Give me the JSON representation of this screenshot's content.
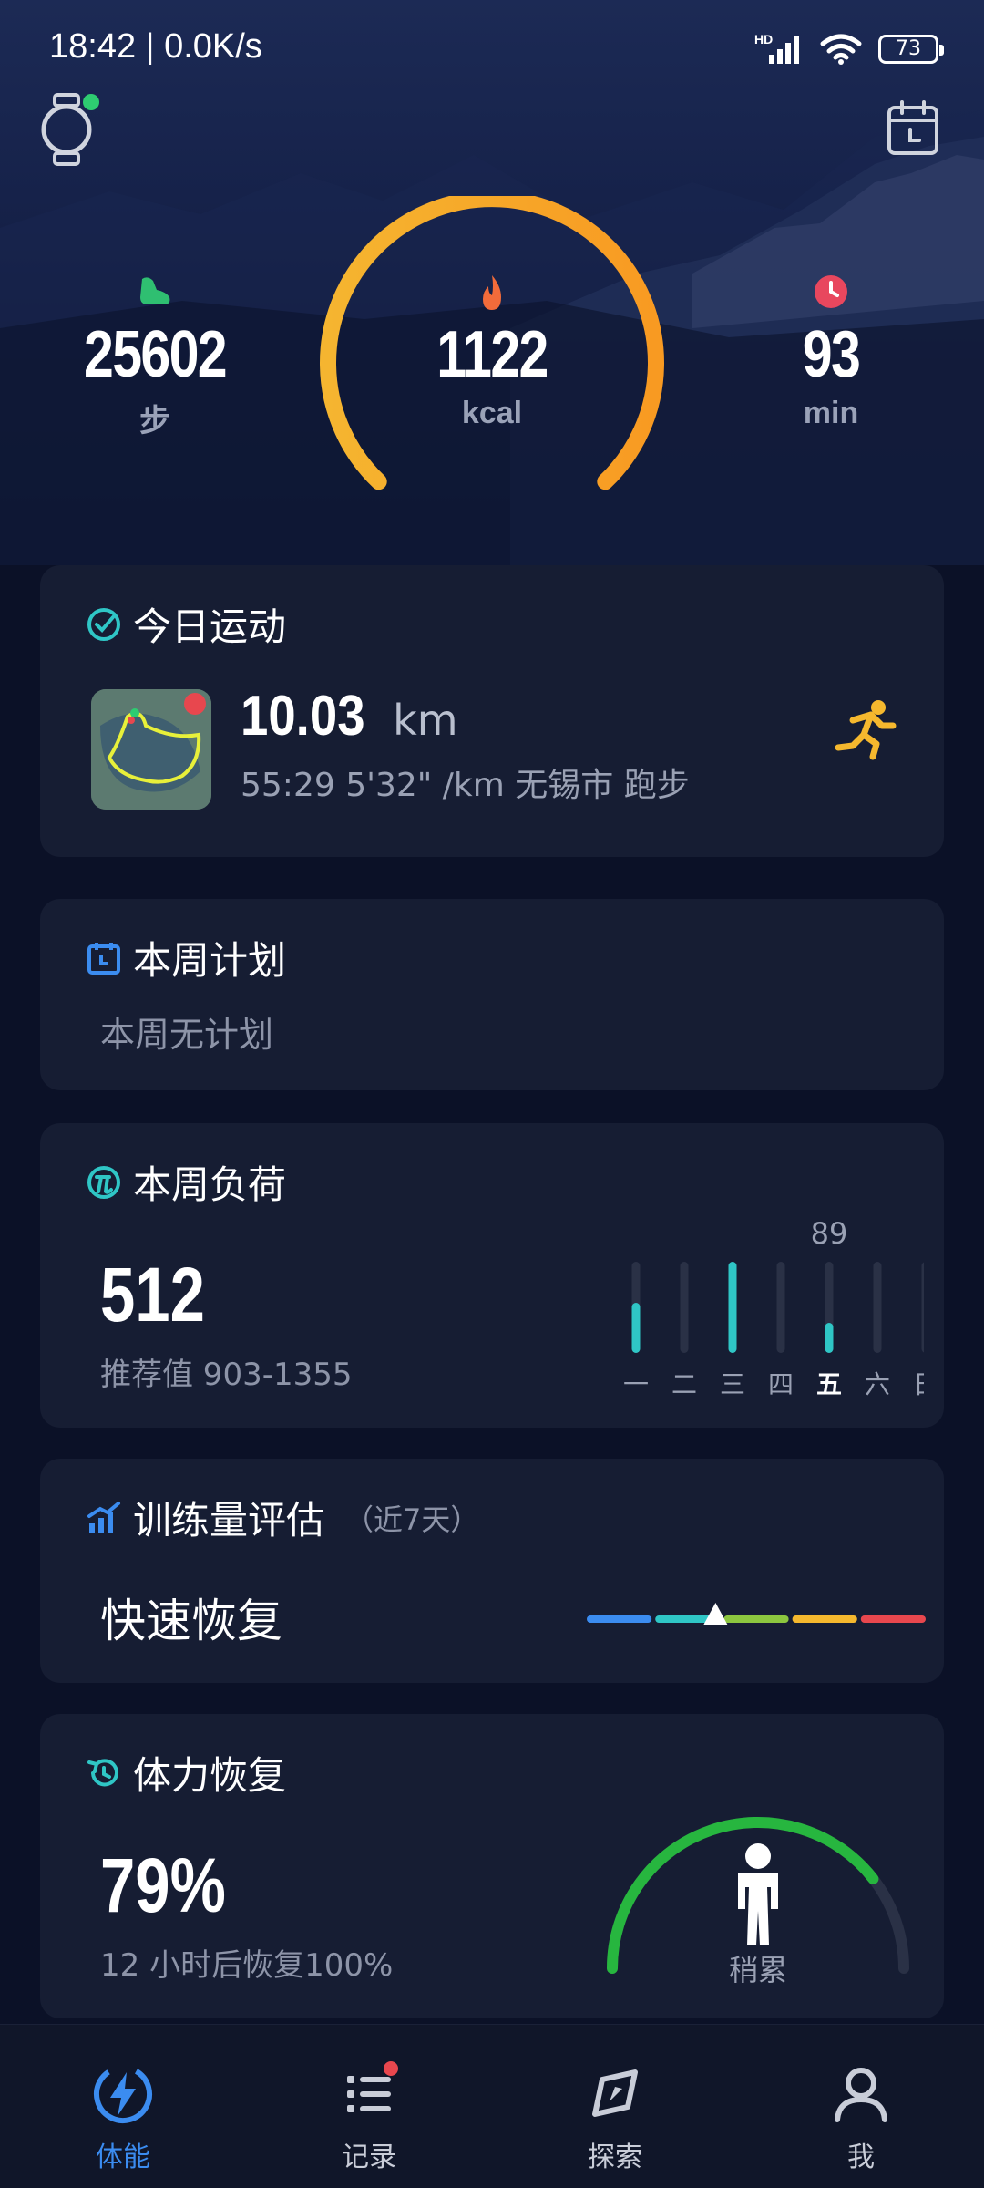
{
  "status_bar": {
    "time": "18:42 | 0.0K/s",
    "network": "HD",
    "battery": "73"
  },
  "hero": {
    "steps_value": "25602",
    "steps_unit": "步",
    "kcal_value": "1122",
    "kcal_unit": "kcal",
    "min_value": "93",
    "min_unit": "min",
    "ring_progress": 1.0
  },
  "today_sport": {
    "title": "今日运动",
    "distance": "10.03",
    "distance_unit": "km",
    "details": "55:29  5'32\" /km  无锡市 跑步"
  },
  "weekly_plan": {
    "title": "本周计划",
    "empty_text": "本周无计划"
  },
  "weekly_load": {
    "title": "本周负荷",
    "value": "512",
    "recommended": "推荐值 903-1355",
    "highlight_value": "89",
    "days": [
      "一",
      "二",
      "三",
      "四",
      "五",
      "六",
      "日"
    ],
    "day_levels": [
      0.55,
      0,
      1.0,
      0,
      0.33,
      0,
      0
    ],
    "active_day_index": 4
  },
  "training_eval": {
    "title": "训练量评估",
    "subtitle": "（近7天）",
    "status": "快速恢复",
    "scale_colors": [
      "#3b8cf0",
      "#2fc6c6",
      "#8cc63f",
      "#f5b82e",
      "#e8474e"
    ],
    "marker_position": 0.38
  },
  "recovery": {
    "title": "体力恢复",
    "value": "79%",
    "detail": "12 小时后恢复100%",
    "figure_label": "稍累",
    "progress": 0.79
  },
  "bottom_nav": {
    "items": [
      {
        "label": "体能",
        "icon": "bolt-icon"
      },
      {
        "label": "记录",
        "icon": "list-icon"
      },
      {
        "label": "探索",
        "icon": "compass-icon"
      },
      {
        "label": "我",
        "icon": "user-icon"
      }
    ],
    "active_index": 0
  },
  "colors": {
    "accent_blue": "#3b8cf0",
    "ring_orange": "#f7a928",
    "teal": "#2fc6c6",
    "green": "#27b63f"
  }
}
